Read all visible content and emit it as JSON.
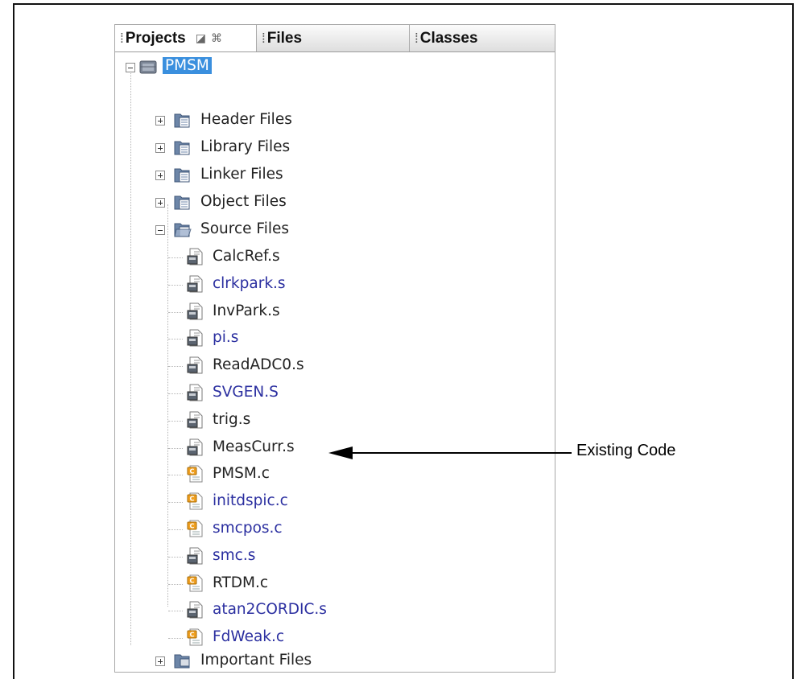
{
  "tabs": {
    "projects": "Projects",
    "files": "Files",
    "classes": "Classes"
  },
  "tree": {
    "project": "PMSM",
    "folders": {
      "header": "Header Files",
      "library": "Library Files",
      "linker": "Linker Files",
      "object": "Object Files",
      "source": "Source Files",
      "important": "Important Files"
    },
    "source_files": [
      {
        "name": "CalcRef.s",
        "color": "#222222",
        "icon": "asm-file-icon"
      },
      {
        "name": "clrkpark.s",
        "color": "#2b2fa0",
        "icon": "asm-file-icon"
      },
      {
        "name": "InvPark.s",
        "color": "#222222",
        "icon": "asm-file-icon"
      },
      {
        "name": "pi.s",
        "color": "#2b2fa0",
        "icon": "asm-file-icon"
      },
      {
        "name": "ReadADC0.s",
        "color": "#222222",
        "icon": "asm-file-icon"
      },
      {
        "name": "SVGEN.S",
        "color": "#2b2fa0",
        "icon": "asm-file-icon"
      },
      {
        "name": "trig.s",
        "color": "#222222",
        "icon": "asm-file-icon"
      },
      {
        "name": "MeasCurr.s",
        "color": "#222222",
        "icon": "asm-file-icon"
      },
      {
        "name": "PMSM.c",
        "color": "#222222",
        "icon": "c-file-icon"
      },
      {
        "name": "initdspic.c",
        "color": "#2b2fa0",
        "icon": "c-file-icon"
      },
      {
        "name": "smcpos.c",
        "color": "#2b2fa0",
        "icon": "c-file-icon"
      },
      {
        "name": "smc.s",
        "color": "#2b2fa0",
        "icon": "asm-file-icon"
      },
      {
        "name": "RTDM.c",
        "color": "#222222",
        "icon": "c-file-icon"
      },
      {
        "name": "atan2CORDIC.s",
        "color": "#2b2fa0",
        "icon": "asm-file-icon"
      },
      {
        "name": "FdWeak.c",
        "color": "#2b2fa0",
        "icon": "c-file-icon"
      }
    ]
  },
  "annotation": {
    "text": "Existing Code"
  },
  "colors": {
    "selection": "#3a8fde",
    "modified_file": "#2b2fa0",
    "normal_file": "#222222"
  }
}
